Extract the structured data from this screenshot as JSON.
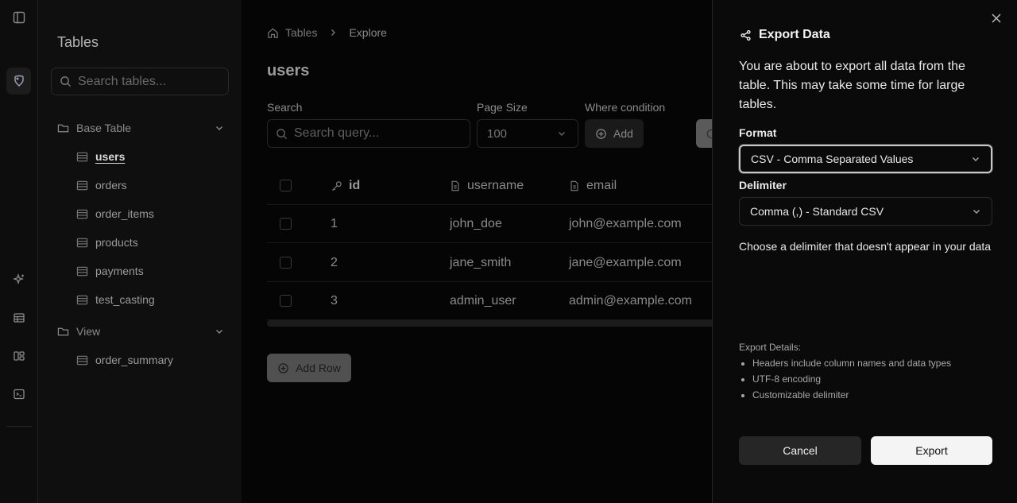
{
  "rail": {
    "icons": [
      "sidebar-toggle-icon",
      "database-icon",
      "sparkles-icon",
      "table-icon",
      "layout-icon",
      "terminal-icon"
    ]
  },
  "sidebar": {
    "title": "Tables",
    "search_placeholder": "Search tables...",
    "groups": [
      {
        "label": "Base Table",
        "items": [
          "users",
          "orders",
          "order_items",
          "products",
          "payments",
          "test_casting"
        ]
      },
      {
        "label": "View",
        "items": [
          "order_summary"
        ]
      }
    ]
  },
  "main": {
    "breadcrumb": [
      "Tables",
      "Explore"
    ],
    "title": "users",
    "filters": {
      "search_label": "Search",
      "search_placeholder": "Search query...",
      "page_size_label": "Page Size",
      "page_size_value": "100",
      "where_label": "Where condition",
      "where_add": "Add"
    },
    "table": {
      "columns": [
        "id",
        "username",
        "email"
      ],
      "rows": [
        [
          "1",
          "john_doe",
          "john@example.com"
        ],
        [
          "2",
          "jane_smith",
          "jane@example.com"
        ],
        [
          "3",
          "admin_user",
          "admin@example.com"
        ]
      ]
    },
    "add_row": "Add Row"
  },
  "dialog": {
    "title": "Export Data",
    "description": "You are about to export all data from the table. This may take some time for large tables.",
    "format_label": "Format",
    "format_value": "CSV - Comma Separated Values",
    "delimiter_label": "Delimiter",
    "delimiter_value": "Comma (,) - Standard CSV",
    "delimiter_hint": "Choose a delimiter that doesn't appear in your data",
    "details_title": "Export Details:",
    "details": [
      "Headers include column names and data types",
      "UTF-8 encoding",
      "Customizable delimiter"
    ],
    "cancel": "Cancel",
    "export": "Export"
  }
}
